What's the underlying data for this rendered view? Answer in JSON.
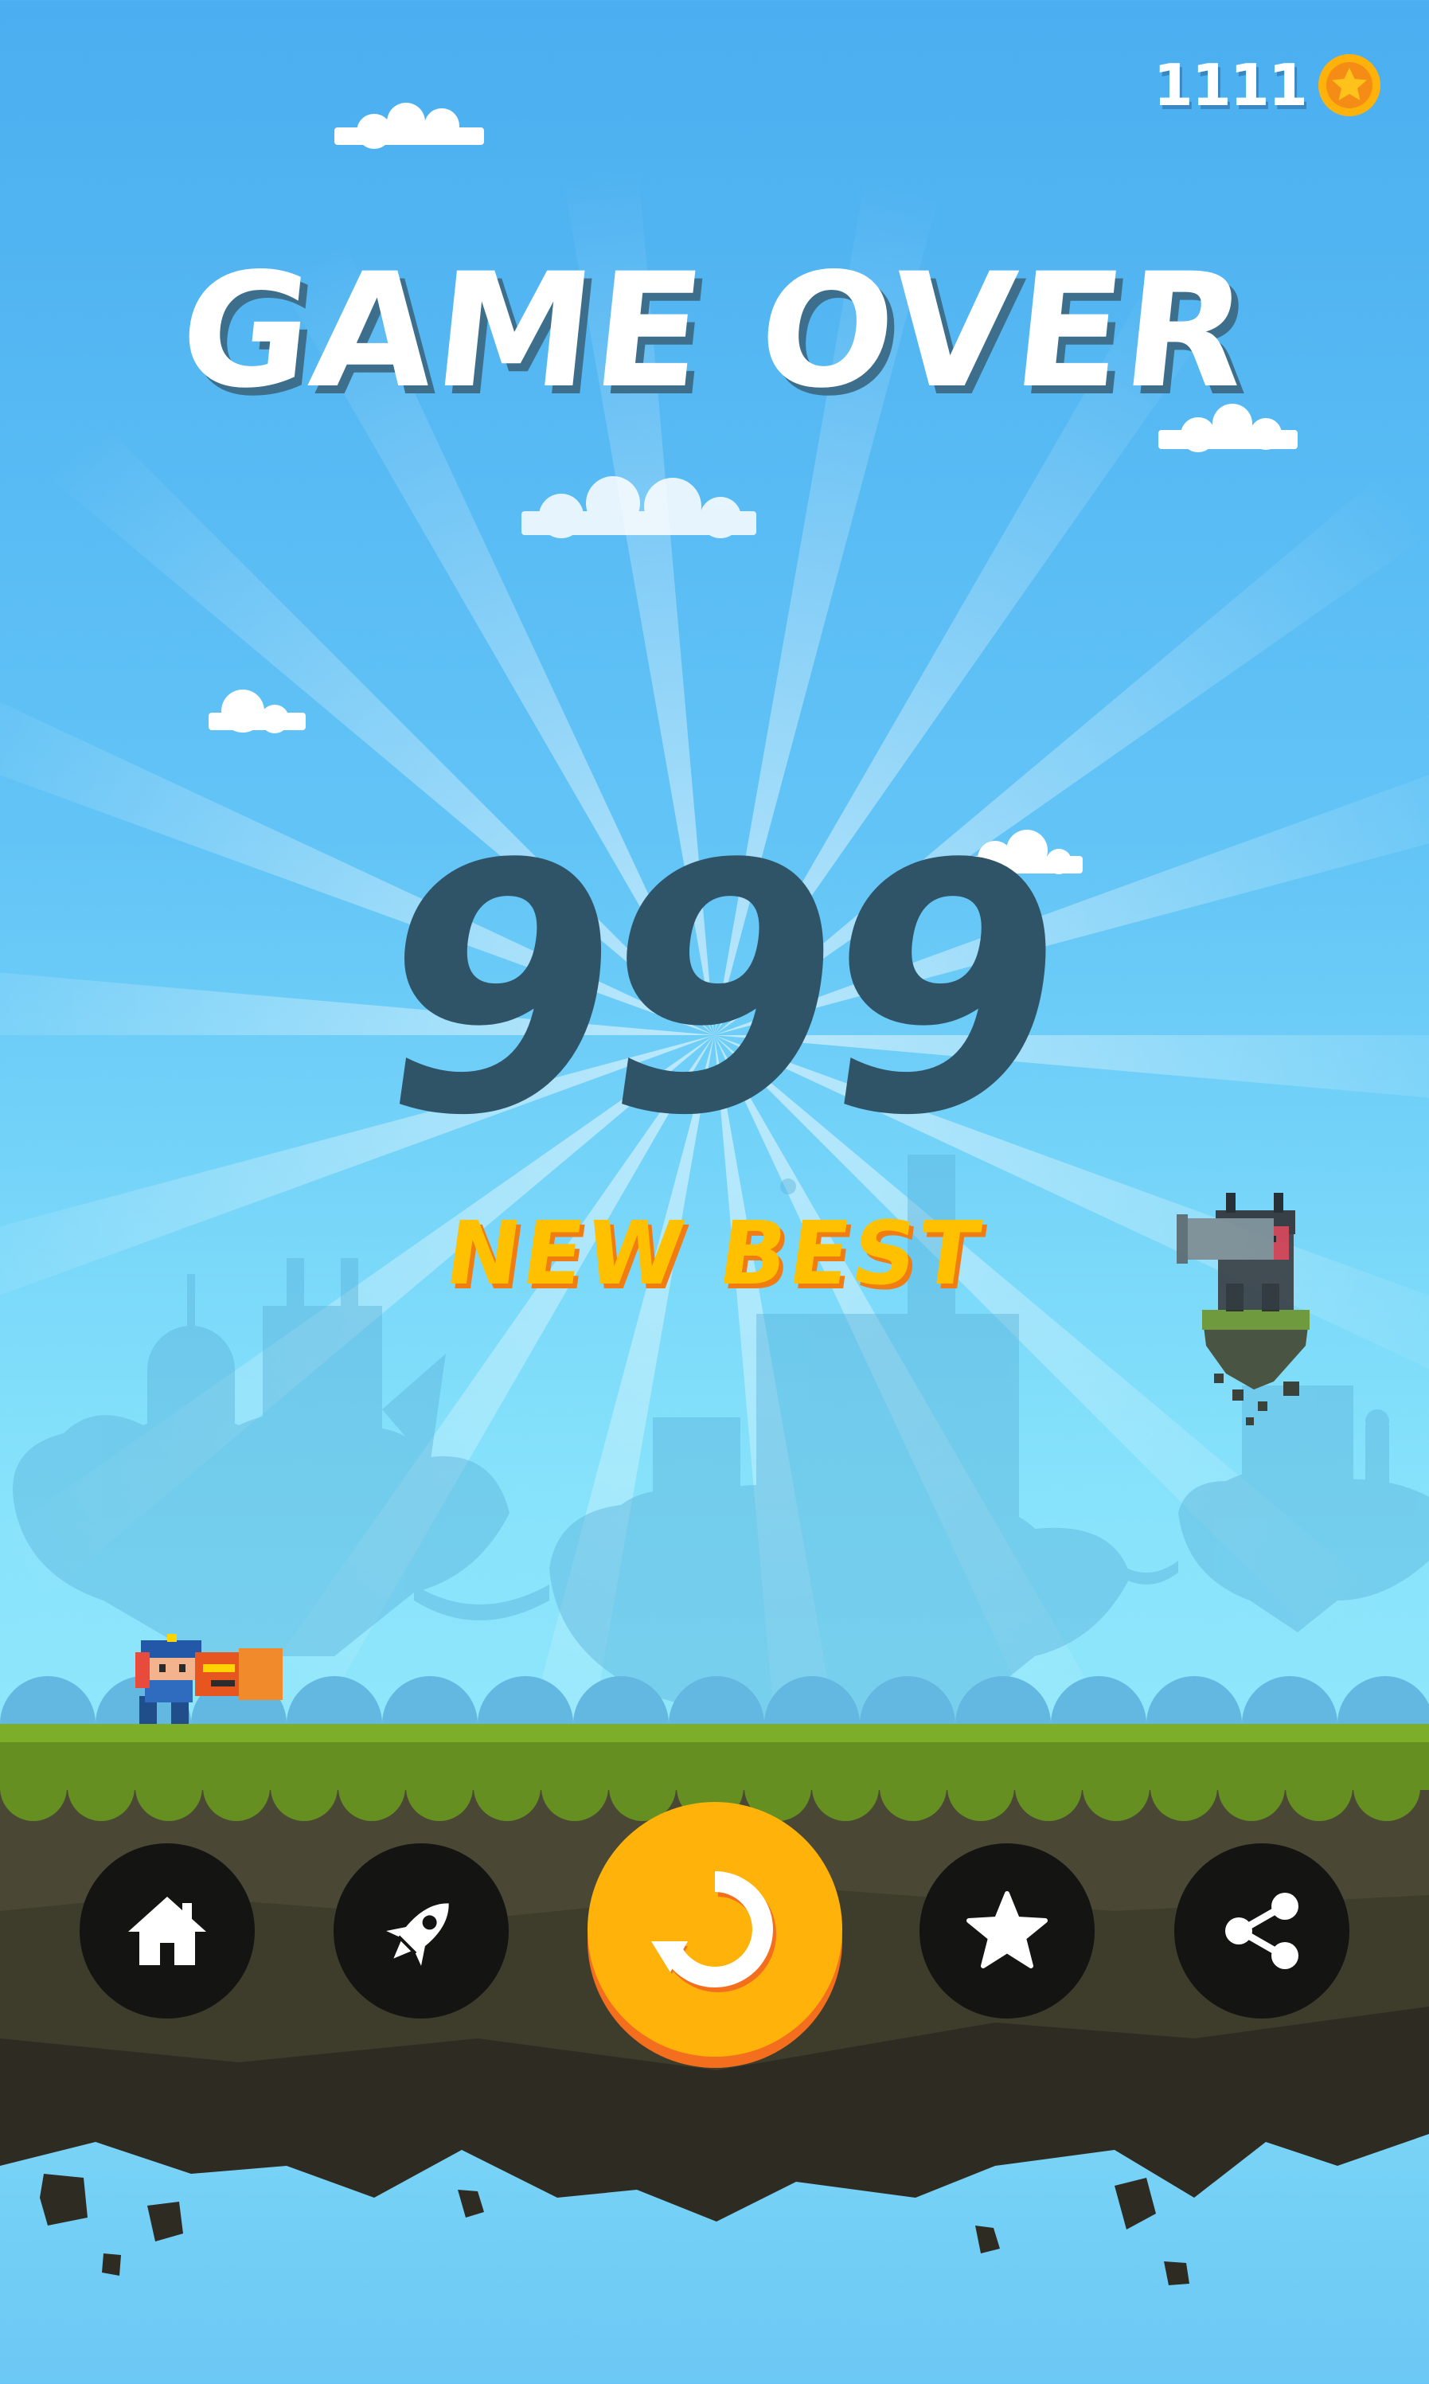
{
  "hud": {
    "coins": "1111",
    "coin_icon": "star-coin-icon"
  },
  "screen": {
    "title": "GAME OVER",
    "score": "999",
    "badge": "NEW BEST"
  },
  "buttons": {
    "home": "home-icon",
    "rocket": "rocket-icon",
    "replay": "replay-icon",
    "rate": "star-icon",
    "share": "share-icon"
  },
  "colors": {
    "sky_top": "#4aaef0",
    "sky_light": "#8ee6fb",
    "score": "#2f5468",
    "title_shadow": "#3d6f8c",
    "badge": "#ffc000",
    "badge_shadow": "#f07c12",
    "replay_button": "#ffb20a",
    "button_dark": "#141412",
    "grass": "#7cae2a",
    "soil": "#3e3d2c"
  }
}
